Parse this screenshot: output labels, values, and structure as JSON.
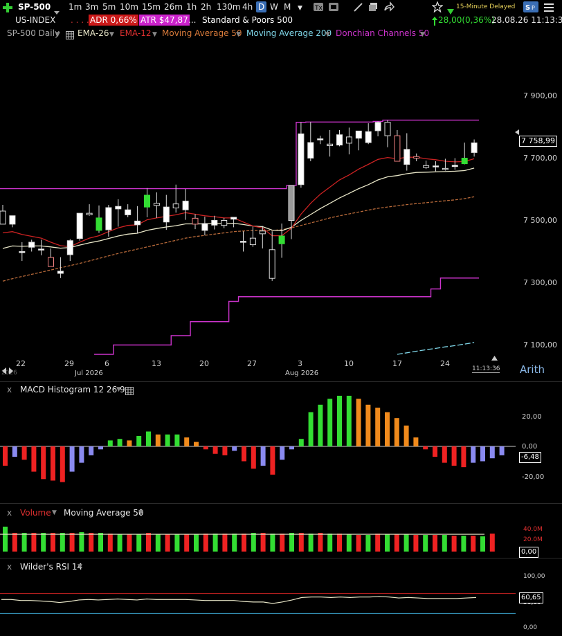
{
  "toolbar": {
    "symbol": "SP-500",
    "timeframes": [
      "1m",
      "3m",
      "5m",
      "10m",
      "15m",
      "26m",
      "1h",
      "2h",
      "130m",
      "4h",
      "D",
      "W",
      "M"
    ],
    "active_timeframe": "D",
    "delay_label": "15-Minute Delayed"
  },
  "header": {
    "index": "US-INDEX",
    "dots": ". . . . .",
    "adr_label": "ADR",
    "adr_value": "0,66%",
    "atr_label": "ATR",
    "atr_value": "$47,87",
    "atr_dots": "...",
    "name": "Standard & Poors 500",
    "change": "28,00(0,36%)",
    "datetime": "28.08.26 11:13:36"
  },
  "indicators": {
    "chart_label": "SP-500 Daily",
    "ema26": "EMA-26",
    "ema12": "EMA-12",
    "ma50": "Moving Average 50",
    "ma200": "Moving Average 200",
    "donchian": "Donchian Channels 50"
  },
  "price_axis": [
    "7 900,00",
    "7 700,00",
    "7 500,00",
    "7 300,00",
    "7 100,00"
  ],
  "last_price": "7 758,99",
  "date_axis": [
    "22",
    "29",
    "6",
    "13",
    "20",
    "27",
    "3",
    "10",
    "17",
    "24"
  ],
  "month_labels": [
    "Jul 2026",
    "Aug 2026"
  ],
  "year_fragment": "2026",
  "time_label": "11:13:36",
  "scale_mode": "Arith",
  "macd": {
    "label": "MACD Histogram 12 26 9",
    "axis": [
      "20,00",
      "0,00",
      "-20,00"
    ],
    "value": "-6,48"
  },
  "volume": {
    "label": "Volume",
    "ma_label": "Moving Average 50",
    "axis": [
      "40.0M",
      "20.0M"
    ],
    "value": "0,00"
  },
  "rsi": {
    "label": "Wilder's RSI 14",
    "axis": [
      "100,00",
      "50,00",
      "0,00"
    ],
    "value": "60,65"
  },
  "colors": {
    "up": "#33dd33",
    "down": "#ee2222",
    "donchian": "#cc33cc",
    "ema12": "#cc2222",
    "ema26": "#e8e6c8",
    "ma50": "#b86a3a",
    "ma200": "#7fd6e8",
    "macd_orange": "#f08a1c",
    "macd_blue": "#8a8af0"
  },
  "chart_data": {
    "type": "candlestick",
    "dates": [
      "Jun 19",
      "Jun 22",
      "Jun 23",
      "Jun 24",
      "Jun 25",
      "Jun 26",
      "Jun 29",
      "Jun 30",
      "Jul 1",
      "Jul 2",
      "Jul 6",
      "Jul 7",
      "Jul 8",
      "Jul 9",
      "Jul 10",
      "Jul 13",
      "Jul 14",
      "Jul 15",
      "Jul 16",
      "Jul 17",
      "Jul 20",
      "Jul 21",
      "Jul 22",
      "Jul 23",
      "Jul 24",
      "Jul 27",
      "Jul 28",
      "Jul 29",
      "Jul 30",
      "Jul 31",
      "Aug 3",
      "Aug 4",
      "Aug 5",
      "Aug 6",
      "Aug 7",
      "Aug 10",
      "Aug 11",
      "Aug 12",
      "Aug 13",
      "Aug 14",
      "Aug 17",
      "Aug 18",
      "Aug 19",
      "Aug 20",
      "Aug 21",
      "Aug 24",
      "Aug 25",
      "Aug 26",
      "Aug 27",
      "Aug 28"
    ],
    "open": [
      7540,
      7498,
      7410,
      7424,
      7418,
      7391,
      7340,
      7400,
      7452,
      7533,
      7478,
      7480,
      7547,
      7528,
      7496,
      7553,
      7565,
      7505,
      7563,
      7544,
      7517,
      7478,
      7495,
      7510,
      7514,
      7441,
      7453,
      7476,
      7416,
      7435,
      7510,
      7625,
      7710,
      7770,
      7755,
      7752,
      7778,
      7774,
      7760,
      7798,
      7825,
      7782,
      7690,
      7715,
      7686,
      7683,
      7677,
      7683,
      7692,
      7728
    ],
    "high": [
      7560,
      7522,
      7440,
      7448,
      7448,
      7420,
      7392,
      7450,
      7532,
      7562,
      7558,
      7560,
      7578,
      7562,
      7556,
      7614,
      7600,
      7592,
      7625,
      7611,
      7530,
      7522,
      7525,
      7518,
      7518,
      7475,
      7490,
      7492,
      7475,
      7500,
      7622,
      7825,
      7826,
      7782,
      7800,
      7800,
      7808,
      7792,
      7822,
      7828,
      7832,
      7800,
      7790,
      7725,
      7702,
      7700,
      7708,
      7710,
      7760,
      7770
    ],
    "low": [
      7500,
      7488,
      7380,
      7410,
      7398,
      7362,
      7325,
      7380,
      7445,
      7525,
      7470,
      7458,
      7490,
      7520,
      7468,
      7520,
      7518,
      7480,
      7535,
      7512,
      7482,
      7462,
      7481,
      7485,
      7488,
      7410,
      7425,
      7420,
      7316,
      7390,
      7450,
      7615,
      7700,
      7755,
      7715,
      7748,
      7722,
      7735,
      7755,
      7780,
      7745,
      7710,
      7670,
      7700,
      7675,
      7668,
      7670,
      7673,
      7690,
      7715
    ],
    "close": [
      7498,
      7525,
      7410,
      7440,
      7418,
      7362,
      7347,
      7445,
      7533,
      7528,
      7518,
      7551,
      7555,
      7544,
      7508,
      7591,
      7558,
      7553,
      7550,
      7572,
      7498,
      7500,
      7510,
      7494,
      7520,
      7443,
      7432,
      7467,
      7324,
      7460,
      7622,
      7788,
      7760,
      7772,
      7750,
      7785,
      7758,
      7797,
      7795,
      7825,
      7782,
      7700,
      7738,
      7710,
      7680,
      7685,
      7676,
      7687,
      7710,
      7759
    ],
    "donchian_upper": [
      7612,
      7612,
      7612,
      7612,
      7612,
      7612,
      7612,
      7612,
      7612,
      7612,
      7612,
      7612,
      7612,
      7612,
      7612,
      7612,
      7612,
      7612,
      7612,
      7612,
      7612,
      7612,
      7612,
      7612,
      7612,
      7612,
      7612,
      7612,
      7612,
      7612,
      7622,
      7825,
      7826,
      7826,
      7826,
      7826,
      7826,
      7826,
      7826,
      7828,
      7832,
      7832,
      7832,
      7832,
      7832,
      7832,
      7832,
      7832,
      7832,
      7832
    ],
    "donchian_lower": [
      null,
      null,
      null,
      null,
      null,
      null,
      null,
      null,
      null,
      null,
      7080,
      7080,
      7110,
      7110,
      7110,
      7110,
      7110,
      7110,
      7140,
      7140,
      7185,
      7185,
      7185,
      7185,
      7250,
      7265,
      7265,
      7265,
      7265,
      7265,
      7265,
      7265,
      7265,
      7265,
      7265,
      7265,
      7265,
      7265,
      7265,
      7265,
      7265,
      7265,
      7265,
      7265,
      7265,
      7290,
      7325,
      7325,
      7325,
      7325
    ],
    "ema12": [
      7470,
      7474,
      7465,
      7459,
      7453,
      7440,
      7429,
      7426,
      7440,
      7453,
      7461,
      7474,
      7486,
      7494,
      7496,
      7512,
      7518,
      7523,
      7528,
      7535,
      7530,
      7525,
      7522,
      7518,
      7518,
      7505,
      7492,
      7486,
      7461,
      7461,
      7485,
      7530,
      7565,
      7594,
      7617,
      7640,
      7656,
      7675,
      7690,
      7706,
      7712,
      7708,
      7713,
      7713,
      7708,
      7705,
      7700,
      7698,
      7699,
      7708
    ],
    "ema26": [
      7420,
      7428,
      7427,
      7428,
      7428,
      7425,
      7421,
      7423,
      7431,
      7438,
      7444,
      7452,
      7460,
      7466,
      7469,
      7478,
      7484,
      7489,
      7493,
      7499,
      7499,
      7499,
      7500,
      7500,
      7501,
      7497,
      7492,
      7490,
      7479,
      7477,
      7488,
      7510,
      7529,
      7548,
      7565,
      7582,
      7597,
      7612,
      7625,
      7640,
      7650,
      7654,
      7660,
      7664,
      7665,
      7666,
      7667,
      7668,
      7670,
      7678
    ],
    "ma50": [
      7315,
      7323,
      7330,
      7337,
      7344,
      7351,
      7358,
      7365,
      7372,
      7380,
      7388,
      7396,
      7404,
      7411,
      7418,
      7425,
      7432,
      7439,
      7446,
      7453,
      7458,
      7462,
      7466,
      7470,
      7474,
      7476,
      7478,
      7479,
      7478,
      7480,
      7486,
      7494,
      7502,
      7510,
      7518,
      7525,
      7531,
      7537,
      7543,
      7549,
      7553,
      7557,
      7561,
      7564,
      7567,
      7570,
      7573,
      7576,
      7580,
      7586
    ],
    "ma200": [
      null,
      null,
      null,
      null,
      null,
      null,
      null,
      null,
      null,
      null,
      null,
      null,
      null,
      null,
      null,
      null,
      null,
      null,
      null,
      null,
      null,
      null,
      null,
      null,
      null,
      null,
      null,
      null,
      null,
      null,
      null,
      null,
      null,
      null,
      null,
      null,
      null,
      null,
      null,
      null,
      null,
      7080,
      7085,
      7090,
      7095,
      7099,
      7104,
      7108,
      7113,
      7118
    ],
    "macd_hist": [
      -13,
      -7,
      -9,
      -17,
      -22,
      -23,
      -24,
      -17,
      -11,
      -6,
      -2,
      4,
      5,
      4,
      7,
      10,
      8,
      8,
      8,
      6,
      3,
      -2,
      -5,
      -6,
      -3,
      -10,
      -15,
      -13,
      -19,
      -9,
      -2,
      5,
      23,
      28,
      32,
      34,
      34,
      32,
      28,
      26,
      23,
      19,
      14,
      6,
      -2,
      -7,
      -11,
      -13,
      -14,
      -11,
      -10,
      -8,
      -6
    ],
    "volume": [
      36,
      27,
      27,
      27,
      27,
      27,
      27,
      27,
      28,
      27,
      27,
      26,
      25,
      25,
      25,
      27,
      25,
      25,
      25,
      25,
      25,
      26,
      26,
      26,
      26,
      26,
      27,
      27,
      26,
      26,
      27,
      27,
      26,
      27,
      26,
      26,
      25,
      24,
      24,
      26,
      25,
      25,
      25,
      24,
      24,
      24,
      24,
      23,
      23,
      23,
      22,
      26
    ],
    "volume_ma50": [
      25,
      25,
      25,
      25,
      25,
      25,
      25,
      25,
      25,
      25,
      25,
      25,
      25,
      25,
      25,
      25,
      25,
      25,
      25,
      25,
      25,
      25,
      25,
      25,
      25,
      25,
      25,
      25,
      25,
      25,
      25,
      25,
      25,
      25,
      25,
      25,
      25,
      25,
      25,
      25,
      25,
      25,
      25,
      25,
      25,
      25,
      25,
      25,
      25,
      25,
      25,
      25
    ],
    "rsi": [
      58,
      58,
      56,
      56,
      55,
      54,
      52,
      54,
      57,
      58,
      57,
      58,
      59,
      58,
      57,
      59,
      58,
      58,
      58,
      58,
      57,
      56,
      56,
      56,
      56,
      54,
      53,
      53,
      50,
      53,
      57,
      62,
      63,
      63,
      62,
      63,
      62,
      63,
      63,
      64,
      63,
      61,
      62,
      61,
      60,
      60,
      60,
      60,
      61,
      62
    ],
    "rsi_levels": [
      70,
      30
    ],
    "ylim_price": [
      7030,
      8030
    ]
  }
}
